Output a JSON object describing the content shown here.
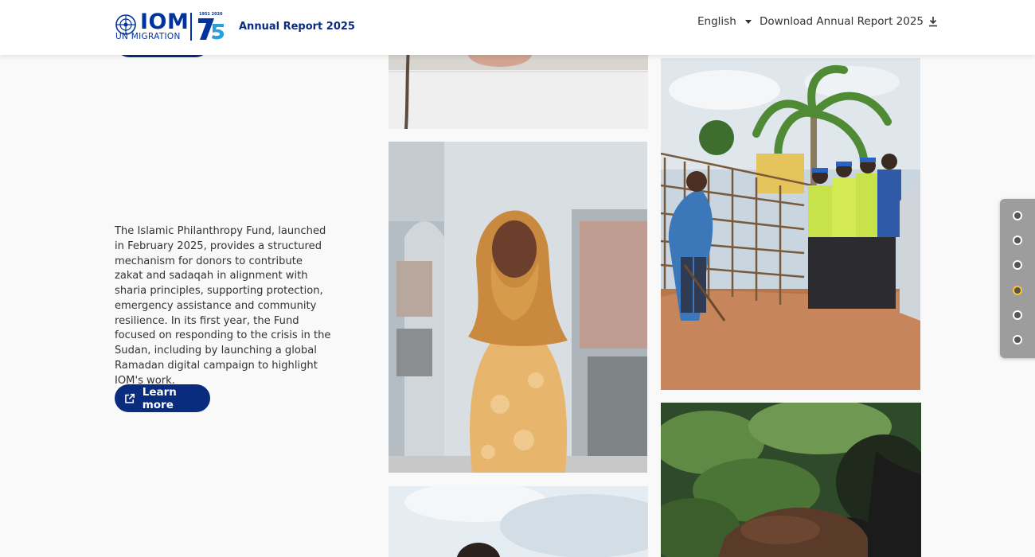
{
  "header": {
    "logo": {
      "brand": "IOM",
      "subtitle": "UN MIGRATION",
      "anniversary": "75",
      "years": "1951 2026"
    },
    "report_title": "Annual Report 2025",
    "language": "English",
    "download_label": "Download Annual Report 2025"
  },
  "main": {
    "paragraph": "The Islamic Philanthropy Fund, launched in February 2025, provides a structured mechanism for donors to contribute zakat and sadaqah in alignment with sharia principles, supporting protection, emergency assistance and community resilience. In its first year, the Fund focused on responding to the crisis in the Sudan, including by launching a global Ramadan digital campaign to highlight IOM's work.",
    "learn_more_label": "Learn more"
  },
  "section_nav": {
    "count": 6,
    "active_index": 3
  },
  "colors": {
    "brand_blue": "#0a2c7e",
    "accent_yellow": "#ffc52e",
    "nav_bg": "#9d9d9d"
  },
  "icons": [
    "chevron-down-icon",
    "download-icon",
    "external-link-icon"
  ]
}
